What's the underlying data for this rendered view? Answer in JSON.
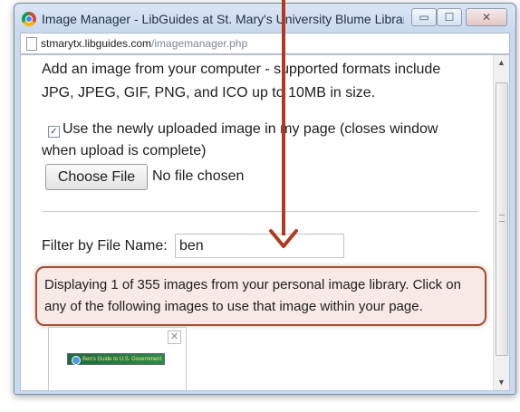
{
  "window": {
    "title": "Image Manager - LibGuides at St. Mary's University Blume Library -...",
    "buttons": {
      "minimize": "▭",
      "maximize": "☐",
      "close": "✕"
    }
  },
  "address": {
    "host": "stmarytx.libguides.com",
    "path": "/imagemanager.php"
  },
  "upload": {
    "intro_line1": "Add an image from your computer - supported formats include",
    "intro_line2": "JPG, JPEG, GIF, PNG, and ICO up to 10MB in size.",
    "checkbox_label_line1": "Use the newly uploaded image in my page (closes window",
    "checkbox_label_line2": "when upload is complete)",
    "checkbox_checked": true,
    "choose_button": "Choose File",
    "file_status": "No file chosen"
  },
  "filter": {
    "label": "Filter by File Name:",
    "value": "ben"
  },
  "notice": {
    "text": "Displaying 1 of 355 images from your personal image library. Click on any of the following images to use that image within your page."
  },
  "thumbnail": {
    "caption": "Ben's Guide to U.S. Government",
    "close": "✕"
  },
  "annotation": {
    "color": "#b03a1f"
  }
}
